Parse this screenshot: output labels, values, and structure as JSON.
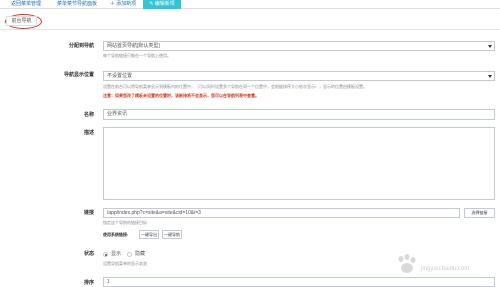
{
  "tabs": [
    {
      "label": "返回菜单管理",
      "active": false
    },
    {
      "label": "菜单菜节导航面板",
      "active": false
    },
    {
      "label": "＋ 添加新项",
      "active": false
    },
    {
      "label": "✎ 编辑新项",
      "active": true
    }
  ],
  "breadcrumb": "前台导航",
  "fields": {
    "group": {
      "label": "分配到导航",
      "value": "网站首页导航[默认类型]",
      "help": "每个导航链接只能在一个导航上使用。"
    },
    "position": {
      "label": "导航显示位置",
      "value": "不设置位置",
      "help": "设置在前台可以将导航菜单显示到模板内的位置中，（可以同时设置多个导航在同一个位置中，会根据排序大小依次显示），显示的位置由模板设置。",
      "warning": "注意：如果您改了模板未设置的位置时，该新排将不会显示，您可以在导航列表中查看。"
    },
    "name": {
      "label": "名称",
      "value": "业界资讯"
    },
    "description": {
      "label": "描述",
      "value": ""
    },
    "link": {
      "label": "链接",
      "value": "/app/index.php?c=site&a=site&cid=10&i=3",
      "select_button": "选择链接",
      "help": "指定这个导航的链接目标",
      "quick_label": "使用系统链接:",
      "quick_buttons": [
        "一键导出",
        "一键导航"
      ]
    },
    "status": {
      "label": "状态",
      "options": [
        {
          "label": "显示",
          "checked": true
        },
        {
          "label": "隐藏",
          "checked": false
        }
      ],
      "help": "设置导航菜单的显示状态"
    },
    "sort": {
      "label": "排序",
      "value": "1"
    }
  },
  "watermark": "jingyan.baidu.com",
  "colors": {
    "accent": "#32c5d2",
    "link": "#1f6fb2",
    "warning": "#d9311c"
  }
}
